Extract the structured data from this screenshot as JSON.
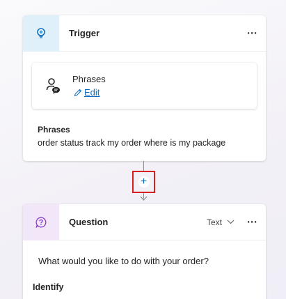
{
  "trigger_node": {
    "title": "Trigger",
    "icon": "lightbulb-icon",
    "more_label": "···",
    "phrases_box": {
      "icon": "person-chat-icon",
      "label": "Phrases",
      "edit_label": "Edit"
    },
    "summary_title": "Phrases",
    "summary_text": "order status track my order where is my package"
  },
  "add_node": {
    "symbol": "+"
  },
  "question_node": {
    "title": "Question",
    "icon": "question-bubble-icon",
    "type_label": "Text",
    "more_label": "···",
    "prompt": "What would you like to do with your order?",
    "identify_label": "Identify"
  },
  "colors": {
    "accent": "#0f6cbd",
    "trigger_header_bg": "#dff0fb",
    "question_header_bg": "#f1e7f8",
    "highlight_border": "#d92020",
    "connector": "#8a8a8a"
  }
}
